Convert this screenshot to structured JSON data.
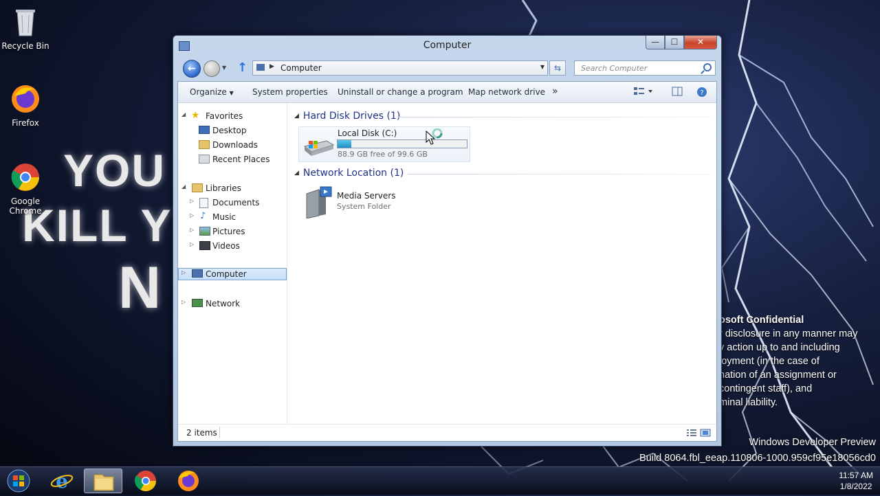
{
  "wallpaper": {
    "lines": [
      "YOU",
      "KILL Y",
      "N"
    ],
    "confidential_title": "osoft Confidential",
    "confidential_lines": [
      "r disclosure in any manner may",
      "y action up to and including",
      "loyment (in the case of",
      "nation of an assignment or",
      "contingent staff), and",
      "minal liability."
    ],
    "build_title": "Windows Developer Preview",
    "build_number": "Build 8064.fbl_eeap.110806-1000.959cf95e18056cd0"
  },
  "desktop_icons": [
    {
      "label": "Recycle Bin",
      "icon": "recycle-bin-icon"
    },
    {
      "label": "Firefox",
      "icon": "firefox-icon"
    },
    {
      "label": "Google Chrome",
      "icon": "chrome-icon"
    }
  ],
  "window": {
    "title": "Computer",
    "caption": {
      "minimize": "—",
      "maximize": "☐",
      "close": "✕"
    }
  },
  "address": {
    "path": "Computer",
    "search_placeholder": "Search Computer"
  },
  "commands": {
    "organize": "Organize",
    "system_properties": "System properties",
    "uninstall": "Uninstall or change a program",
    "map_drive": "Map network drive",
    "more": "»"
  },
  "nav": {
    "favorites": "Favorites",
    "desktop": "Desktop",
    "downloads": "Downloads",
    "recent_places": "Recent Places",
    "libraries": "Libraries",
    "documents": "Documents",
    "music": "Music",
    "pictures": "Pictures",
    "videos": "Videos",
    "computer": "Computer",
    "network": "Network"
  },
  "groups": {
    "hard_disk": "Hard Disk Drives (1)",
    "network": "Network Location (1)"
  },
  "drive": {
    "name": "Local Disk (C:)",
    "free_text": "88.9 GB free of 99.6 GB",
    "used_fraction": 0.107
  },
  "network_item": {
    "name": "Media Servers",
    "type": "System Folder"
  },
  "status": {
    "items": "2 items"
  },
  "clock": {
    "time": "11:57 AM",
    "date": "1/8/2022"
  }
}
